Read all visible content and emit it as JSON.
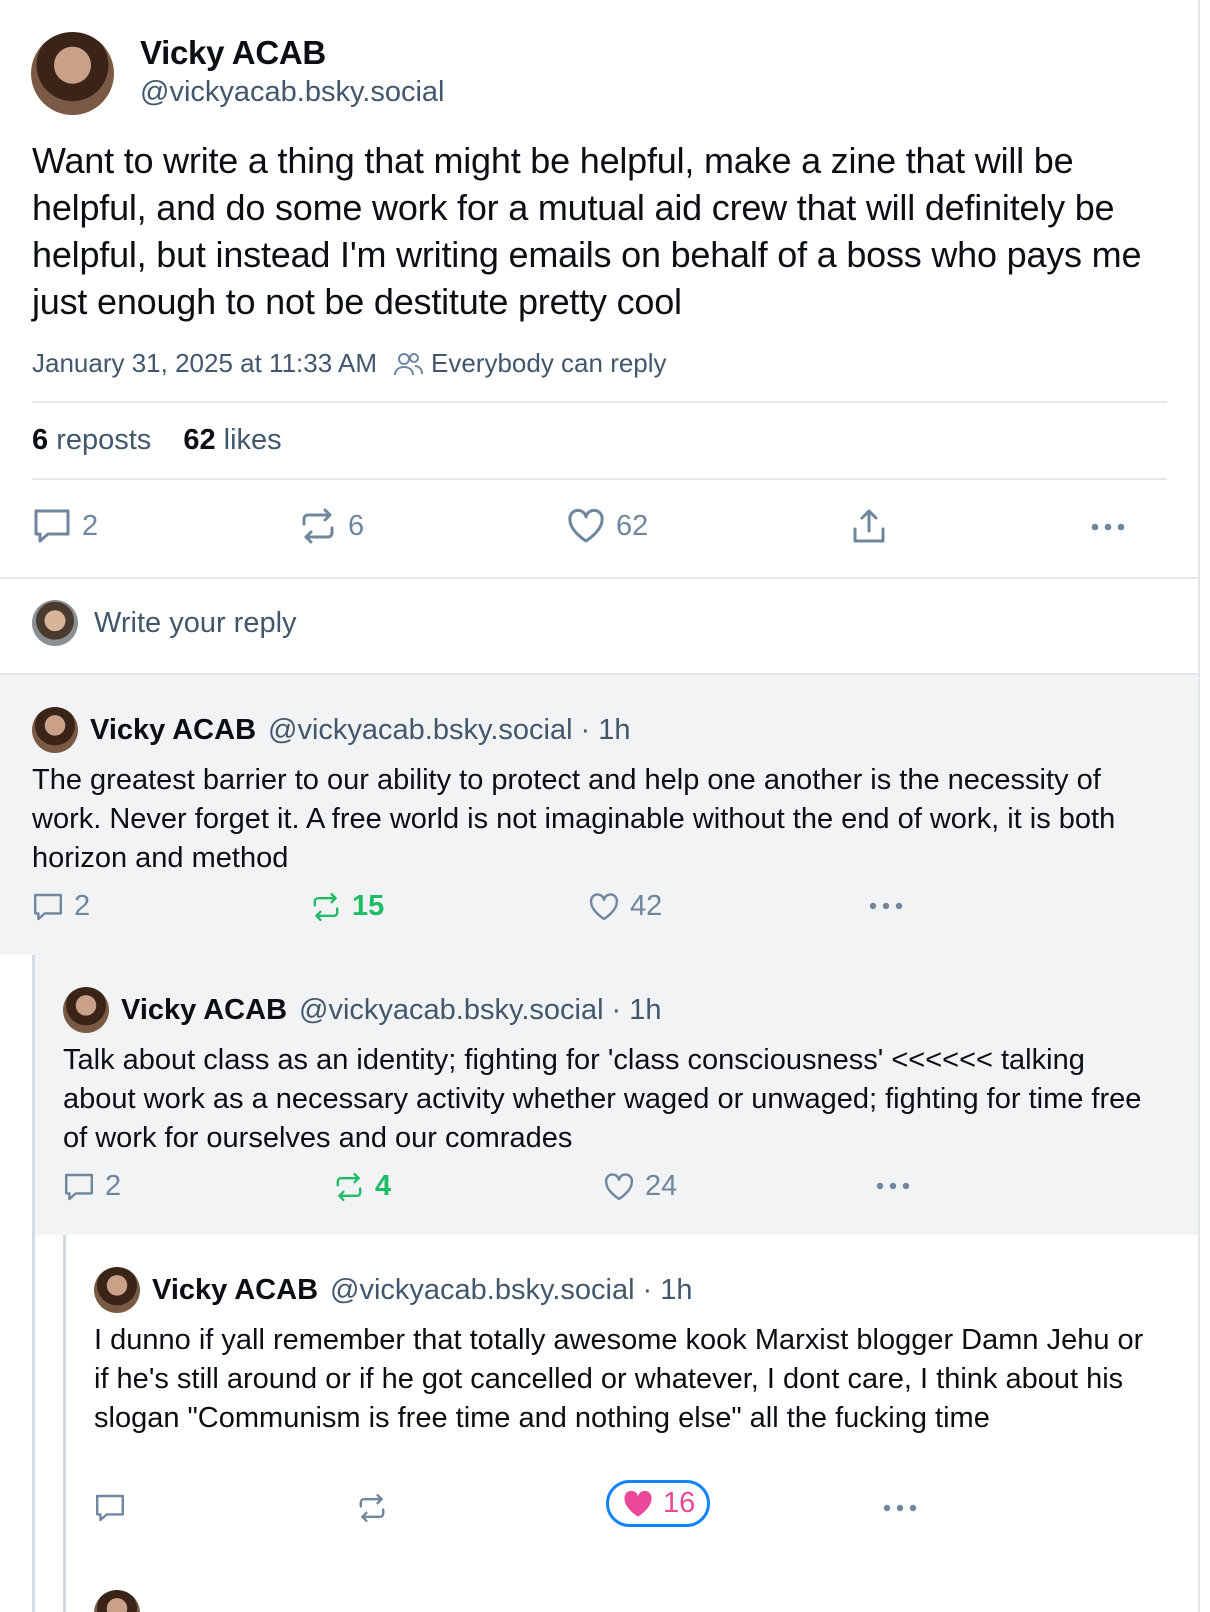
{
  "post": {
    "author_name": "Vicky ACAB",
    "author_handle": "@vickyacab.bsky.social",
    "text": "Want to write a thing that might be helpful, make a zine that will be helpful, and do some work for a mutual aid crew that will definitely be helpful, but instead I'm writing emails on behalf of a boss who pays me just enough to not be destitute pretty cool",
    "timestamp": "January 31, 2025 at 11:33 AM",
    "reply_setting": "Everybody can reply",
    "reposts_count": "6",
    "reposts_label": "reposts",
    "likes_count": "62",
    "likes_label": "likes",
    "actions": {
      "replies": "2",
      "reposts": "6",
      "likes": "62"
    }
  },
  "reply_box": {
    "placeholder": "Write your reply"
  },
  "replies": [
    {
      "author_name": "Vicky ACAB",
      "author_handle": "@vickyacab.bsky.social",
      "time": "· 1h",
      "text": "The greatest barrier to our ability to protect and help one another is the necessity of work. Never forget it. A free world is not imaginable without the end of work, it is both horizon and method",
      "replies": "2",
      "reposts": "15",
      "likes": "42"
    },
    {
      "author_name": "Vicky ACAB",
      "author_handle": "@vickyacab.bsky.social",
      "time": "· 1h",
      "text": "Talk about class as an identity; fighting for 'class consciousness' <<<<<< talking about work as a necessary activity whether waged or unwaged; fighting for time free of work for ourselves and our comrades",
      "replies": "2",
      "reposts": "4",
      "likes": "24"
    },
    {
      "author_name": "Vicky ACAB",
      "author_handle": "@vickyacab.bsky.social",
      "time": "· 1h",
      "text": "I dunno if yall remember that totally awesome kook Marxist blogger Damn Jehu or if he's still around or if he got cancelled or whatever, I dont care, I think about his slogan \"Communism is free time and nothing else\" all the fucking time",
      "likes": "16"
    }
  ],
  "colors": {
    "text": "#0b0f14",
    "muted": "#42576c",
    "icon": "#6f869f",
    "reposted_green": "#20bc63",
    "liked_pink": "#ec4899",
    "focus_blue": "#1083fe",
    "thread_bg": "#f1f3f5"
  }
}
